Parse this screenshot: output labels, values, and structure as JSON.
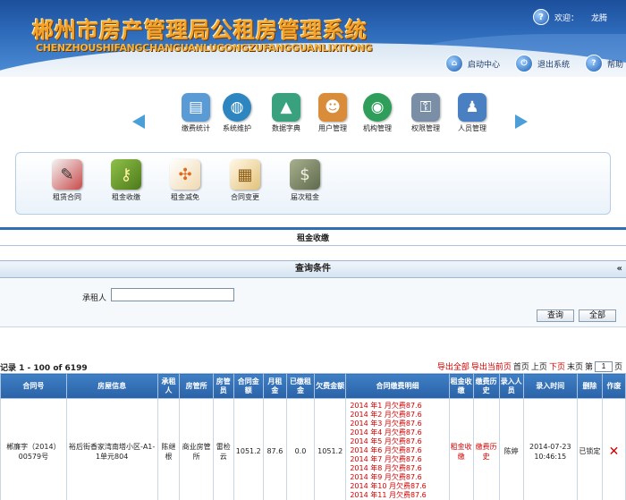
{
  "header": {
    "title_cn": "郴州市房产管理局公租房管理系统",
    "title_en": "CHENZHOUSHIFANGCHANGUANLUGONGZUFANGGUANLIXITONG",
    "welcome_label": "欢迎：",
    "user_name": "龙腾",
    "buttons": [
      {
        "label": "启动中心",
        "icon": "home-icon"
      },
      {
        "label": "退出系统",
        "icon": "exit-icon"
      },
      {
        "label": "帮助",
        "icon": "help-icon"
      }
    ]
  },
  "nav": {
    "items": [
      {
        "label": "缴费统计",
        "icon": "stats-icon",
        "color": "#5b9bd5"
      },
      {
        "label": "系统维护",
        "icon": "globe-icon",
        "color": "#2e86c1"
      },
      {
        "label": "数据字典",
        "icon": "chart-icon",
        "color": "#3aa17e"
      },
      {
        "label": "用户管理",
        "icon": "users-icon",
        "color": "#d98c3a"
      },
      {
        "label": "机构管理",
        "icon": "org-icon",
        "color": "#2f9e5a"
      },
      {
        "label": "权限管理",
        "icon": "key-icon",
        "color": "#7a8fa6"
      },
      {
        "label": "人员管理",
        "icon": "person-icon",
        "color": "#4a7fc1"
      }
    ]
  },
  "sub_menu": {
    "items": [
      {
        "label": "租赁合同",
        "icon": "pen-icon",
        "color": "#b23a3a"
      },
      {
        "label": "租金收缴",
        "icon": "coins-icon",
        "color": "#6a9a2a"
      },
      {
        "label": "租金减免",
        "icon": "mindmap-icon",
        "color": "#e89b3a"
      },
      {
        "label": "合同变更",
        "icon": "document-icon",
        "color": "#d8b46a"
      },
      {
        "label": "届次租金",
        "icon": "money-icon",
        "color": "#6b7b5a"
      }
    ]
  },
  "section_title": "租金收缴",
  "query": {
    "title": "查询条件",
    "collapse": "«",
    "renter_label": "承租人",
    "renter_value": "",
    "search_label": "查询",
    "all_label": "全部"
  },
  "records_text": "记录 1 - 100 of 6199",
  "toolbar": {
    "export_all": "导出全部",
    "export_page": "导出当前页",
    "first": "首页",
    "prev": "上页",
    "next": "下页",
    "last": "末页",
    "goto": "第",
    "page_value": "1",
    "page_unit": "页"
  },
  "table": {
    "headers": [
      "合同号",
      "房屋信息",
      "承租人",
      "房管所",
      "房管员",
      "合同金额",
      "月租金",
      "已缴租金",
      "欠费金额",
      "合同缴费明细",
      "租金收缴",
      "缴费历史",
      "录入人员",
      "录入时间",
      "删除",
      "作废"
    ],
    "row": {
      "contract_no": "郴廉字（2014）00579号",
      "house_info": "裕后街香家湾南塔小区-A1-1单元804",
      "renter": "陈继根",
      "housing_office": "商业房管所",
      "manager": "雷检云",
      "contract_amount": "1051.2",
      "monthly_rent": "87.6",
      "paid": "0.0",
      "arrears": "1051.2",
      "arrears_details": [
        "2014 年1 月欠费87.6",
        "2014 年2 月欠费87.6",
        "2014 年3 月欠费87.6",
        "2014 年4 月欠费87.6",
        "2014 年5 月欠费87.6",
        "2014 年6 月欠费87.6",
        "2014 年7 月欠费87.6",
        "2014 年8 月欠费87.6",
        "2014 年9 月欠费87.6",
        "2014 年10 月欠费87.6",
        "2014 年11 月欠费87.6"
      ],
      "rent_collect": "租金收缴",
      "pay_history": "缴费历史",
      "entered_by": "陈婷",
      "entered_time": "2014-07-23 10:46:15",
      "delete_status": "已锁定",
      "void": "✕"
    }
  }
}
